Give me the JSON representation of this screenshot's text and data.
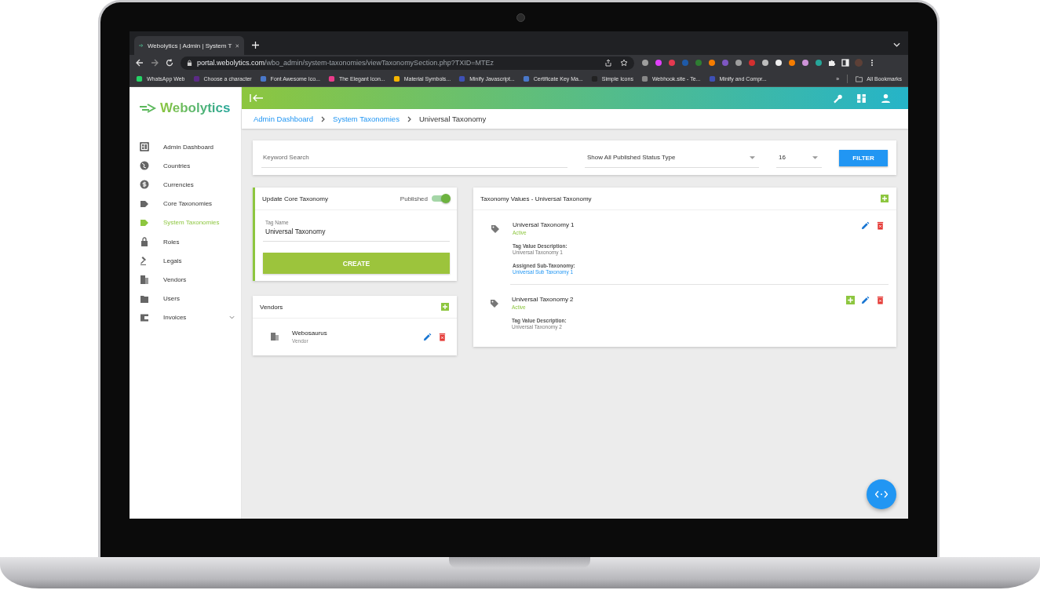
{
  "browser": {
    "tab_title": "Webolytics | Admin | System T",
    "url_host": "portal.webolytics.com",
    "url_path": "/wbo_admin/system-taxonomies/viewTaxonomySection.php?TXID=MTEz",
    "bookmarks": [
      "WhatsApp Web",
      "Choose a character",
      "Font Awesome Ico...",
      "The Elegant Icon...",
      "Material Symbols...",
      "Minify Javascript...",
      "Certificate Key Ma...",
      "Simple Icons",
      "Webhook.site - Te...",
      "Minify and Compr..."
    ],
    "bookmarks_overflow": "»",
    "all_bookmarks": "All Bookmarks"
  },
  "logo": "Webolytics",
  "sidebar": {
    "items": [
      {
        "label": "Admin Dashboard",
        "selected": false
      },
      {
        "label": "Countries",
        "selected": false
      },
      {
        "label": "Currencies",
        "selected": false
      },
      {
        "label": "Core Taxonomies",
        "selected": false
      },
      {
        "label": "System Taxonomies",
        "selected": true
      },
      {
        "label": "Roles",
        "selected": false
      },
      {
        "label": "Legals",
        "selected": false
      },
      {
        "label": "Vendors",
        "selected": false
      },
      {
        "label": "Users",
        "selected": false
      },
      {
        "label": "Invoices",
        "selected": false,
        "expandable": true
      }
    ]
  },
  "breadcrumbs": [
    {
      "label": "Admin Dashboard",
      "kind": "link"
    },
    {
      "label": "System Taxonomies",
      "kind": "link"
    },
    {
      "label": "Universal Taxonomy",
      "kind": "current"
    }
  ],
  "filter": {
    "search_placeholder": "Keyword Search",
    "status_select": "Show All Published Status Type",
    "count_select": "16",
    "button": "FILTER"
  },
  "update_card": {
    "title": "Update Core Taxonomy",
    "toggle_label": "Published",
    "published": true,
    "field_label": "Tag Name",
    "field_value": "Universal Taxonomy",
    "button": "CREATE"
  },
  "vendors_card": {
    "title": "Vendors",
    "items": [
      {
        "name": "Webosaurus",
        "type": "Vendor"
      }
    ]
  },
  "values_card": {
    "title": "Taxonomy Values - Universal Taxonomy",
    "items": [
      {
        "name": "Universal Taxonomy 1",
        "status": "Active",
        "can_add": false,
        "fields": [
          {
            "label": "Tag Value Description:",
            "value": "Universal Taxonomy 1",
            "kind": "text"
          },
          {
            "label": "Assigned Sub-Taxonomy:",
            "value": "Universal Sub Taxonomy 1",
            "kind": "link"
          }
        ]
      },
      {
        "name": "Universal Taxonomy 2",
        "status": "Active",
        "can_add": true,
        "fields": [
          {
            "label": "Tag Value Description:",
            "value": "Universal Taxonomy 2",
            "kind": "text"
          }
        ]
      }
    ]
  }
}
